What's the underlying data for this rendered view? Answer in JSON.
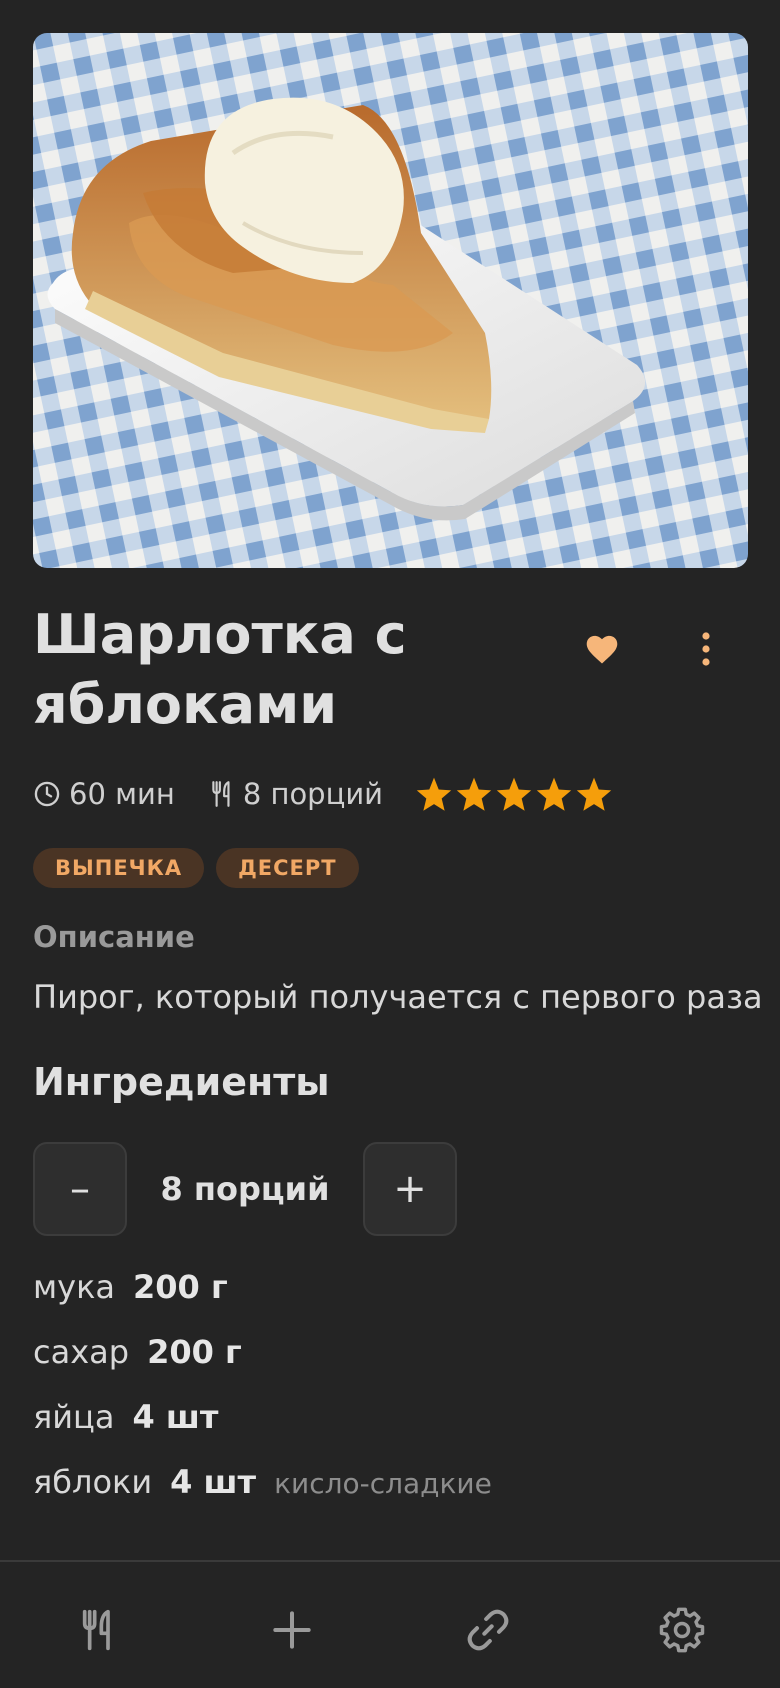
{
  "recipe": {
    "title": "Шарлотка с яблоками",
    "time": "60 мин",
    "servings": "8 порций",
    "rating": 5,
    "rating_max": 5,
    "favorite": true,
    "tags": [
      "ВЫПЕЧКА",
      "ДЕСЕРТ"
    ],
    "description_label": "Описание",
    "description": "Пирог, который получается с первого раза",
    "ingredients_title": "Ингредиенты",
    "stepper": {
      "minus_label": "–",
      "value": "8 порций",
      "plus_label": "+"
    },
    "ingredients": [
      {
        "name": "мука",
        "qty": "200 г",
        "note": ""
      },
      {
        "name": "сахар",
        "qty": "200 г",
        "note": ""
      },
      {
        "name": "яйца",
        "qty": "4 шт",
        "note": ""
      },
      {
        "name": "яблоки",
        "qty": "4 шт",
        "note": "кисло-сладкие"
      }
    ]
  },
  "icons": {
    "favorite": "heart-icon",
    "more": "more-vertical-icon",
    "time": "clock-icon",
    "servings": "cutlery-icon",
    "star": "star-icon"
  },
  "nav": {
    "items": [
      {
        "icon": "cutlery-icon"
      },
      {
        "icon": "plus-icon"
      },
      {
        "icon": "link-icon"
      },
      {
        "icon": "gear-icon"
      }
    ]
  },
  "colors": {
    "background": "#242424",
    "accent": "#f59e0b",
    "heart": "#f6b67a",
    "tag_bg": "#4a3424",
    "tag_text": "#f1a865"
  }
}
